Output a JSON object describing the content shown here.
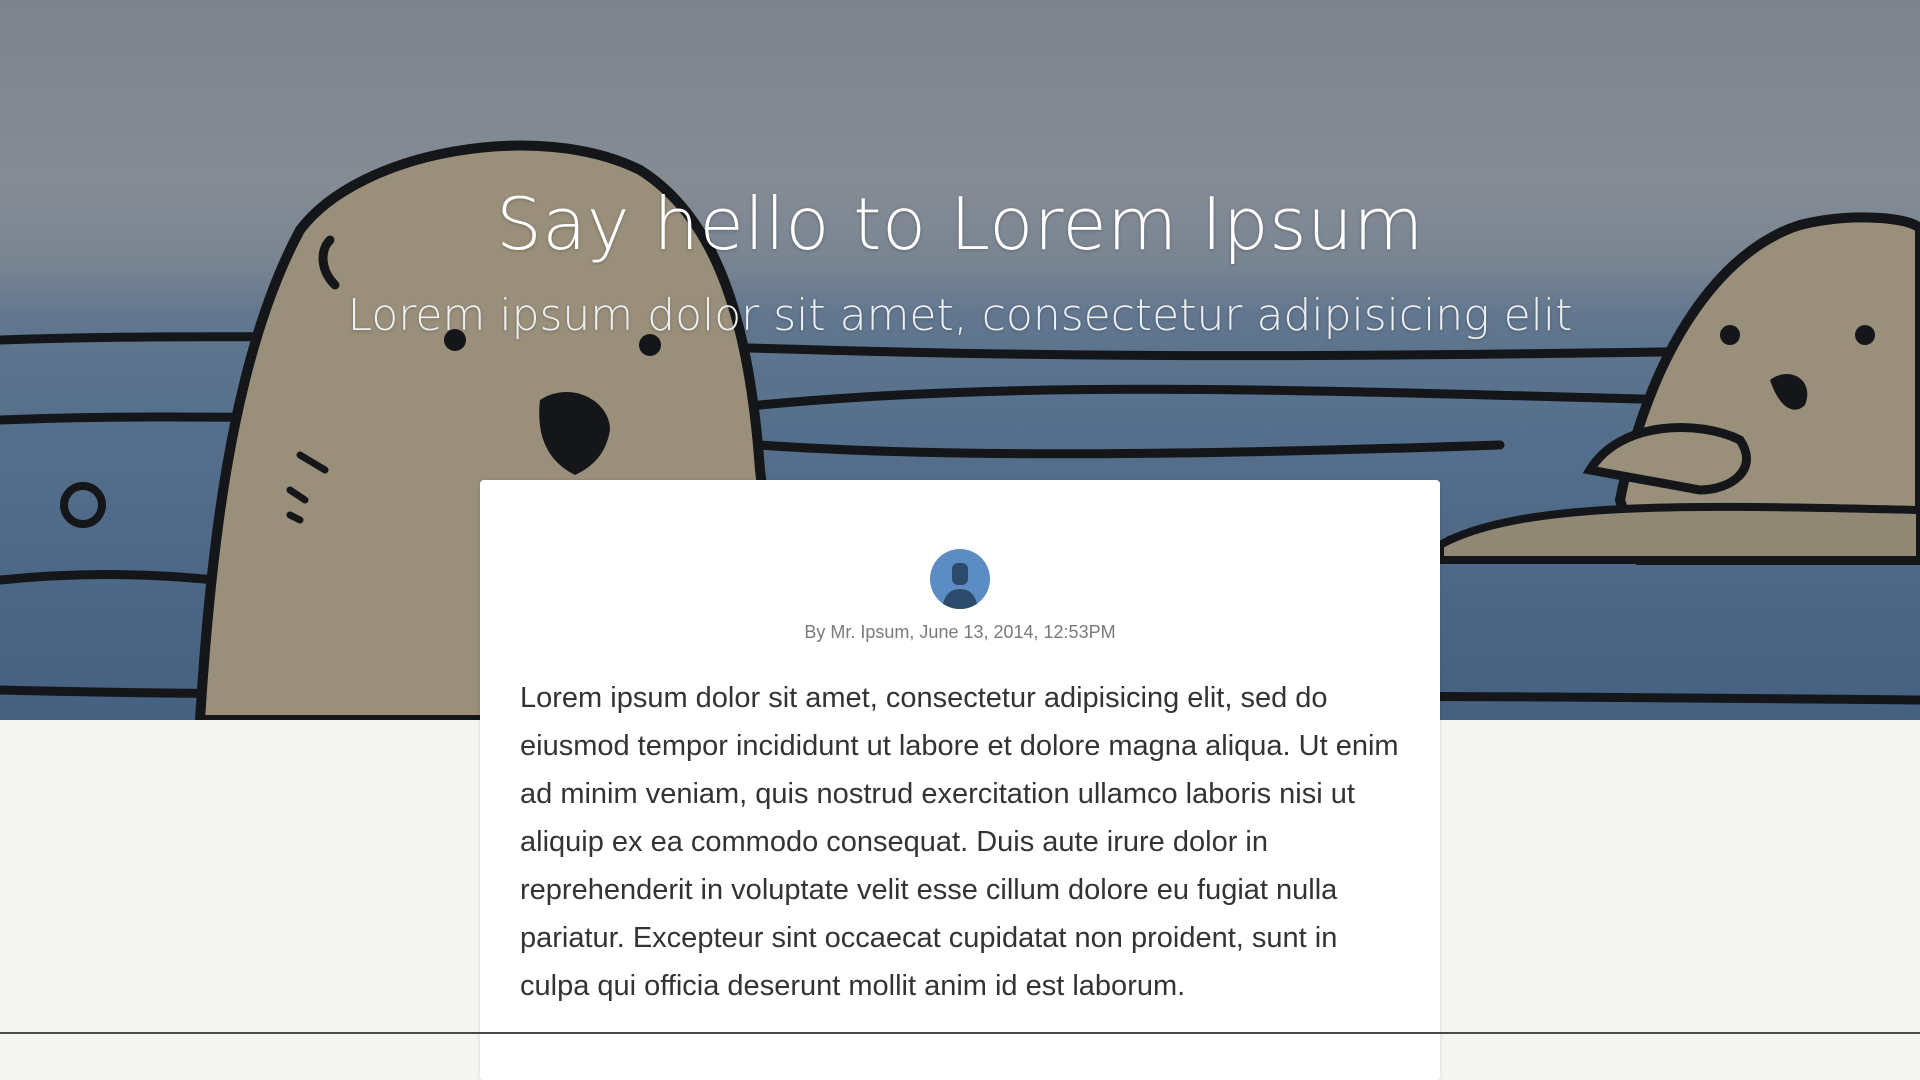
{
  "hero": {
    "title": "Say hello to Lorem Ipsum",
    "subtitle": "Lorem ipsum dolor sit amet, consectetur adipisicing elit"
  },
  "post": {
    "byline": "By Mr. Ipsum, June 13, 2014, 12:53PM",
    "body": "Lorem ipsum dolor sit amet, consectetur adipisicing elit, sed do eiusmod tempor incididunt ut labore et dolore magna aliqua. Ut enim ad minim veniam, quis nostrud exercitation ullamco laboris nisi ut aliquip ex ea commodo consequat. Duis aute irure dolor in reprehenderit in voluptate velit esse cillum dolore eu fugiat nulla pariatur. Excepteur sint occaecat cupidatat non proident, sunt in culpa qui officia deserunt mollit anim id est laborum."
  },
  "icons": {
    "avatar": "user-avatar-icon"
  },
  "colors": {
    "page_background": "#f5f5f1",
    "card_background": "#ffffff",
    "avatar_blue": "#5b8cc4",
    "text_dark": "#333333",
    "text_muted": "#7a7a7a"
  }
}
